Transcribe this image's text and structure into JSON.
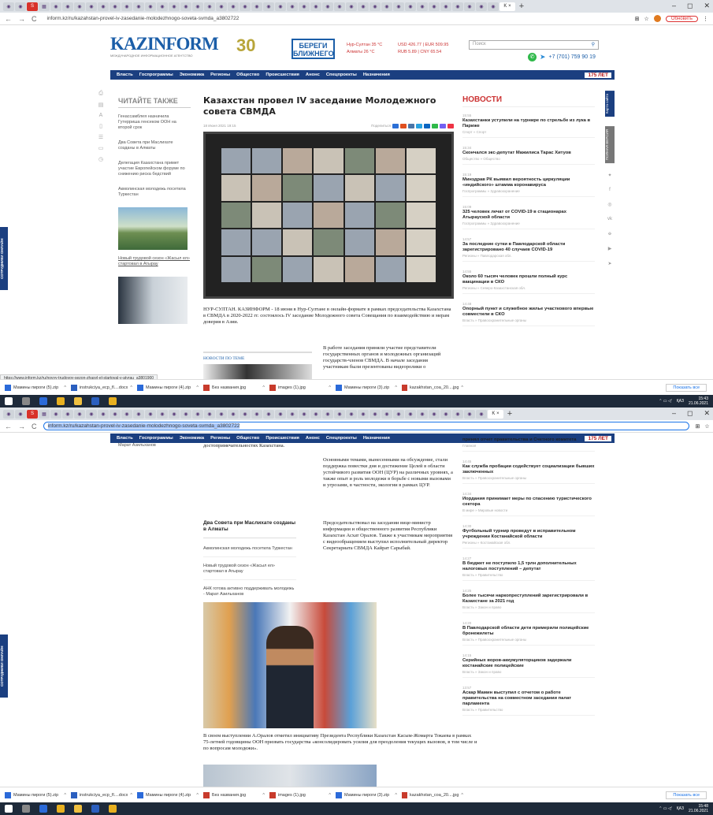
{
  "browser": {
    "url1": "inform.kz/ru/kazahstan-provel-iv-zasedanie-molodezhnogo-soveta-svmda_a3802722",
    "url2": "inform.kz/ru/kazahstan-provel-iv-zasedanie-molodezhnogo-soveta-svmda_a3802722",
    "update_label": "Обновить",
    "status_url": "https://www.inform.kz/ru/novyy-trudovoy-sezon-zhasyl-el-startoval-v-atyrau_a3801900"
  },
  "header": {
    "logo": "KAZINFORM",
    "logo_sub": "МЕЖДУНАРОДНОЕ ИНФОРМАЦИОННОЕ АГЕНТСТВО",
    "anniv": "30",
    "bereg": "БЕРЕГИ БЛИЖНЕГО",
    "weather1": "Нур-Султан 35 °C",
    "weather2": "Алматы 26 °C",
    "rates1": "USD 426.77 | EUR 509.95",
    "rates2": "RUB 5.89 | CNY 65.54",
    "search_placeholder": "Поиск",
    "phone": "+7 (701) 759 90 19"
  },
  "menu": [
    "Власть",
    "Госпрограммы",
    "Экономика",
    "Регионы",
    "Общество",
    "Происшествия",
    "Анонс",
    "Спецпроекты",
    "Назначения"
  ],
  "years_badge": "175 ЛЕТ",
  "left_tab": "СОТРУДНИКИ ОНЛАЙН",
  "right_tab1": "Карта сайта",
  "right_tab2": "ПОЛНАЯ ВЕРСИЯ",
  "read_more": {
    "title": "ЧИТАЙТЕ ТАКЖЕ",
    "items": [
      "Генассамблея назначила Гутерриша генсеком ООН на второй срок",
      "Два Совета при Маслихате созданы в Алматы",
      "Делегация Казахстана примет участие Европейском форуме по снижению риска бедствий",
      "Акмолинская молодежь посетила Туркестан",
      "Новый трудовой сезон «Жасыл ел» стартовал в Атырау"
    ]
  },
  "article": {
    "title": "Казахстан провел IV заседание Молодежного совета СВМДА",
    "date": "18 Июня 2021 19:15",
    "share_label": "Поделиться",
    "lead": "НУР-СУЛТАН. КАЗИНФОРМ - 18 июня в Нур-Султане в онлайн-формате в рамках председательства Казахстана в СВМДА в 2020-2022 гг. состоялось IV заседание Молодежного совета Совещания по взаимодействию и мерам доверия в Азии.",
    "related_head": "НОВОСТИ ПО ТЕМЕ",
    "p1": "В работе заседания приняли участие представители государственных органов и молодежных организаций государств-членов СВМДА. В начале заседания участникам были презентованы видеоролики о",
    "p1_end": "достопримечательностях Казахстана.",
    "p2": "Основными темами, вынесенными на обсуждение, стали поддержка повестки дня и достижение Целей в области устойчивого развития ООН (ЦУР) на различных уровнях, а также опыт и роль молодежи в борьбе с новыми вызовами и угрозами, в частности, экологии в рамках ЦУР.",
    "p3": "Председательствовал на заседании вице-министр информации и общественного развития Республики Казахстан Асхат Оралов. Также к участникам мероприятия с видеообращением выступил исполнительный директор Секретариата СВМДА Кайрат Сарыбай.",
    "caption": "В своем выступлении А.Оралов отметил инициативу Президента Республики Казахстан Касым-Жомарта Токаева в рамках 75-летней годовщины ООН призвать государства «консолидировать усилия для преодоления текущих вызовов, в том числе и по вопросам молодежи»."
  },
  "related2": {
    "prev": "Марат Азильханов",
    "title": "Два Совета при Маслихате созданы в Алматы",
    "items": [
      "Акмолинская молодежь посетила Туркестан",
      "Новый трудовой сезон «Жасыл ел» стартовал в Атырау",
      "АНК готова активно поддерживать молодежь - Марат Азильханов"
    ]
  },
  "news": {
    "title": "НОВОСТИ",
    "items1": [
      {
        "t": "15:55",
        "h": "Казахстанки уступили на турнире по стрельбе из лука в Париже",
        "c": "Спорт » Спорт"
      },
      {
        "t": "15:34",
        "h": "Скончался экс-депутат Мажилиса Тарас Хитуов",
        "c": "Общество » Общество"
      },
      {
        "t": "15:19",
        "h": "Минздрав РК выявил вероятность циркуляции «индийского» штамма коронавируса",
        "c": "Госпрограммы » Здравоохранение"
      },
      {
        "t": "15:09",
        "h": "325 человек лечат от COVID-19 в стационарах Атырауской области",
        "c": "Госпрограммы » Здравоохранение"
      },
      {
        "t": "14:57",
        "h": "За последние сутки в Павлодарской области зарегистрировано 40 случаев COVID-19",
        "c": "Регионы » Павлодарская обл."
      },
      {
        "t": "14:55",
        "h": "Около 60 тысяч человек прошли полный курс вакцинации в СКО",
        "c": "Регионы » Северо-Казахстанская обл."
      },
      {
        "t": "14:48",
        "h": "Опорный пункт и служебное жилье участкового впервые совместили в СКО",
        "c": "Власть » Правоохранительные органы"
      }
    ],
    "top2": "принял отчет правительства и Счетного комитета",
    "top2_cat": "Главная",
    "items2": [
      {
        "t": "14:45",
        "h": "Как служба пробации содействует социализации бывших заключенных",
        "c": "Власть » Правоохранительные органы"
      },
      {
        "t": "14:34",
        "h": "Иордания принимает меры по спасению туристического сектора",
        "c": "В мире » Мировые новости"
      },
      {
        "t": "14:30",
        "h": "Футбольный турнир проведут в исправительном учреждении Костанайской области",
        "c": "Регионы » Костанайская обл."
      },
      {
        "t": "14:27",
        "h": "В бюджет не поступило 1,5 трлн дополнительных налоговых поступлений – депутат",
        "c": "Власть » Правительство"
      },
      {
        "t": "14:25",
        "h": "Более тысячи наркопреступлений зарегистрировали в Казахстане за 2021 год",
        "c": "Власть » Закон и право"
      },
      {
        "t": "14:20",
        "h": "В Павлодарской области дети примерили полицейские бронежилеты",
        "c": "Власть » Правоохранительные органы"
      },
      {
        "t": "14:15",
        "h": "Серийных воров-аккумуляторщиков задержали костанайские полицейские",
        "c": "Власть » Закон и право"
      },
      {
        "t": "13:57",
        "h": "Аскар Мамин выступил с отчетом о работе правительства на совместном заседании палат парламента",
        "c": "Власть » Правительство"
      }
    ]
  },
  "downloads": [
    "Мамины пироги (5).zip",
    "instrukciya_ecp_fl....docx",
    "Мамины пироги (4).zip",
    "Без названия.jpg",
    "images (1).jpg",
    "Мамины пироги (3).zip",
    "kazakhstan_coa_20....jpg"
  ],
  "show_all": "Показать все",
  "tray1_time": "15:43",
  "tray2_time": "15:48",
  "tray_date": "21.06.2021",
  "tray_lang": "ҚАЗ"
}
